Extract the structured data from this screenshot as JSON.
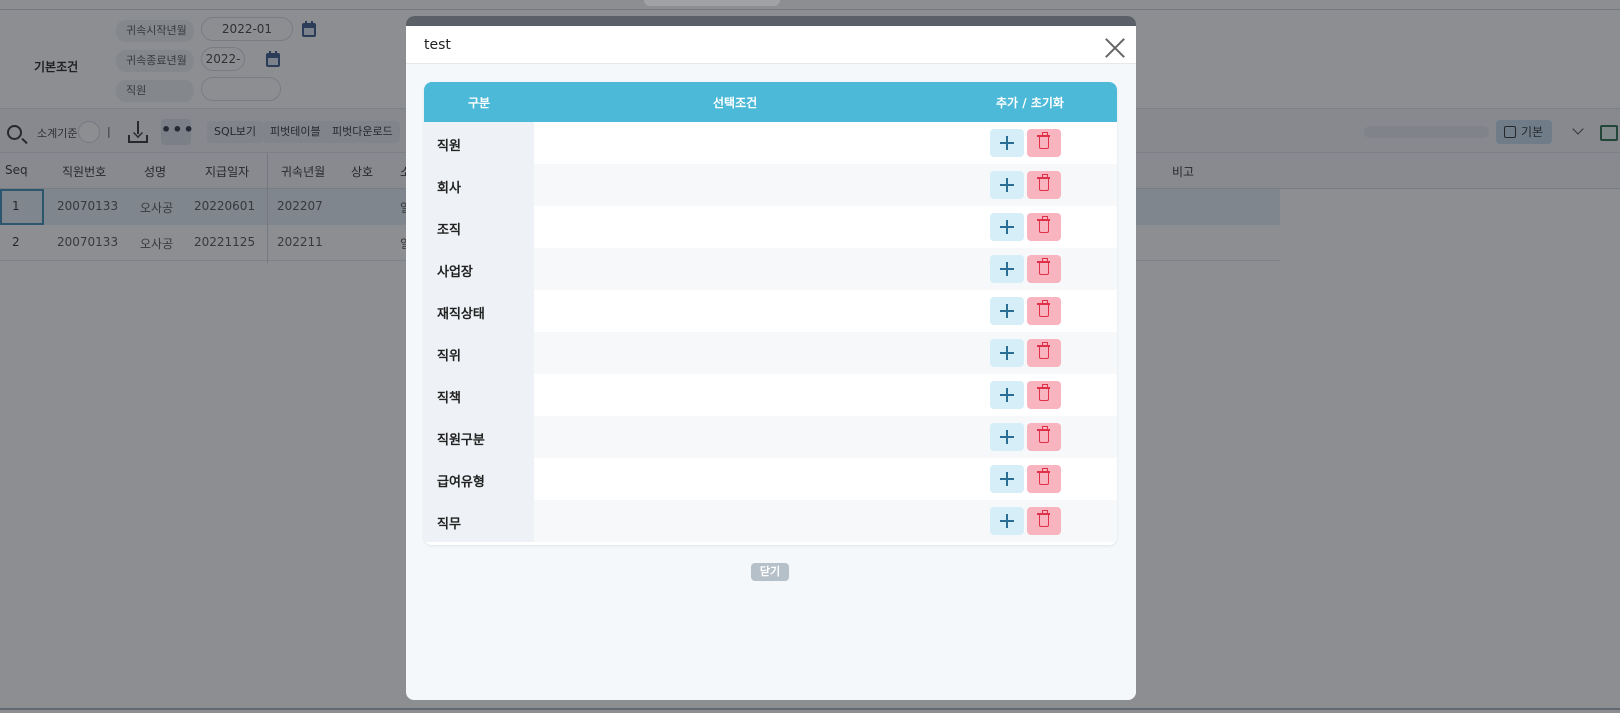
{
  "filters": {
    "section_title": "기본조건",
    "start_label": "귀속시작년월",
    "start_value": "2022-01",
    "end_label": "귀속종료년월",
    "end_value": "2022-",
    "employee_label": "직원",
    "employee_value": ""
  },
  "toolbar": {
    "subtotal_label": "소계기준",
    "separator": "|",
    "more": "•••",
    "sql_view": "SQL보기",
    "pivot_table": "피벗테이블",
    "pivot_download": "피벗다운로드",
    "basic": "기본"
  },
  "grid": {
    "columns": [
      "Seq",
      "직원번호",
      "성명",
      "지급일자",
      "귀속년월",
      "상호",
      "소",
      "비고"
    ],
    "rows": [
      [
        "1",
        "20070133",
        "오사공",
        "20220601",
        "202207",
        "",
        "일"
      ],
      [
        "2",
        "20070133",
        "오사공",
        "20221125",
        "202211",
        "",
        "일"
      ]
    ]
  },
  "modal": {
    "title": "test",
    "columns": [
      "구분",
      "선택조건",
      "추가 / 초기화"
    ],
    "rows": [
      "직원",
      "회사",
      "조직",
      "사업장",
      "재직상태",
      "직위",
      "직책",
      "직원구분",
      "급여유형",
      "직무"
    ],
    "close_label": "닫기"
  },
  "colors": {
    "header_accent": "#4cb9d9",
    "add_button": "#d6eef8",
    "delete_button": "#f8b4bf",
    "selected_row": "#e4eef6"
  }
}
